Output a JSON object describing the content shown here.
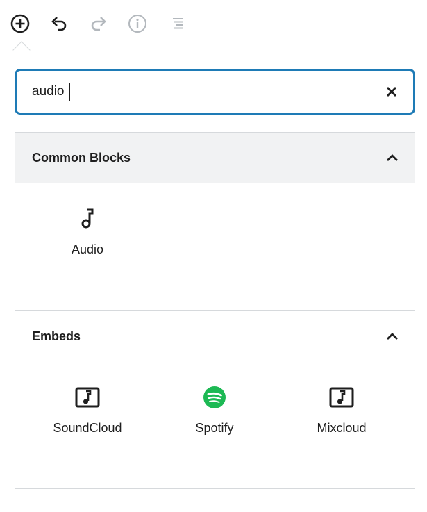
{
  "toolbar": {
    "tools": [
      {
        "name": "add-block",
        "icon": "plus-circle-icon",
        "enabled": true
      },
      {
        "name": "undo",
        "icon": "undo-icon",
        "enabled": true
      },
      {
        "name": "redo",
        "icon": "redo-icon",
        "enabled": false
      },
      {
        "name": "info",
        "icon": "info-icon",
        "enabled": false
      },
      {
        "name": "outline",
        "icon": "list-outline-icon",
        "enabled": false
      }
    ]
  },
  "search": {
    "value": "audio",
    "clear_icon": "close-icon"
  },
  "sections": {
    "common": {
      "title": "Common Blocks",
      "expanded": true,
      "blocks": [
        {
          "label": "Audio",
          "icon": "music-note-icon"
        }
      ]
    },
    "embeds": {
      "title": "Embeds",
      "expanded": true,
      "blocks": [
        {
          "label": "SoundCloud",
          "icon": "music-frame-icon"
        },
        {
          "label": "Spotify",
          "icon": "spotify-icon"
        },
        {
          "label": "Mixcloud",
          "icon": "music-frame-icon"
        }
      ]
    }
  },
  "colors": {
    "accent": "#1e7bb6",
    "text": "#1e1e1e",
    "disabled": "#b3b8bd",
    "section_bg": "#f1f2f3",
    "divider": "#d6d9dc",
    "spotify": "#1db954"
  }
}
